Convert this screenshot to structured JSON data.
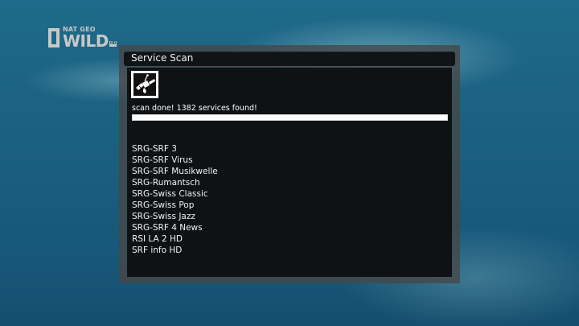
{
  "channel_logo": {
    "small_text": "NAT GEO",
    "big_text": "WILD",
    "badge": "HD",
    "icon": "yellow-frame-icon"
  },
  "scan_window": {
    "title": "Service Scan",
    "icon": "satellite-icon",
    "status": "scan done! 1382 services found!",
    "progress": 1.0,
    "services": [
      "SRG-SRF 3",
      "SRG-SRF Virus",
      "SRG-SRF Musikwelle",
      "SRG-Rumantsch",
      "SRG-Swiss Classic",
      "SRG-Swiss Pop",
      "SRG-Swiss Jazz",
      "SRG-SRF 4 News",
      "RSI LA 2 HD",
      "SRF info HD"
    ]
  },
  "colors": {
    "panel_background": "#0e1214",
    "window_frame": "#464646",
    "text": "#ffffff"
  }
}
